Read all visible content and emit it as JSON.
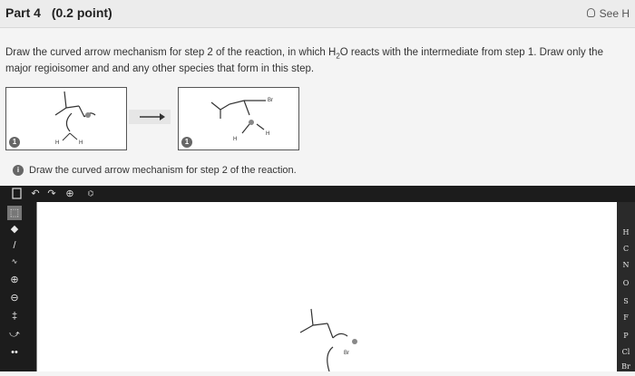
{
  "header": {
    "part_title": "Part 4",
    "points": "(0.2 point)",
    "see_hint": "See H"
  },
  "question": {
    "text_before_h2o": "Draw the curved arrow mechanism for step 2 of the reaction, in which H",
    "subscript": "2",
    "text_after_h2o": "O reacts with the intermediate from step 1. Draw only the major regioisomer and and any other species that form in this step."
  },
  "scheme": {
    "step1_badge": "1",
    "step2_badge": "1",
    "left_atom_labels": [
      "H",
      "H"
    ],
    "right_atom_labels": [
      "Br",
      "H",
      "H"
    ]
  },
  "instruction": {
    "badge": "i",
    "text": "Draw the curved arrow mechanism for step 2 of the reaction."
  },
  "toolbar": {
    "items": [
      "new",
      "undo",
      "redo",
      "zoom",
      "templates"
    ]
  },
  "tools": {
    "items": [
      "select",
      "erase",
      "single-bond",
      "chain",
      "positive-charge",
      "negative-charge",
      "arrow",
      "curved-arrow",
      "lone-pair"
    ]
  },
  "elements": [
    "H",
    "C",
    "N",
    "O",
    "S",
    "F",
    "P",
    "Cl",
    "Br"
  ],
  "canvas": {
    "atom_label": "Br"
  }
}
